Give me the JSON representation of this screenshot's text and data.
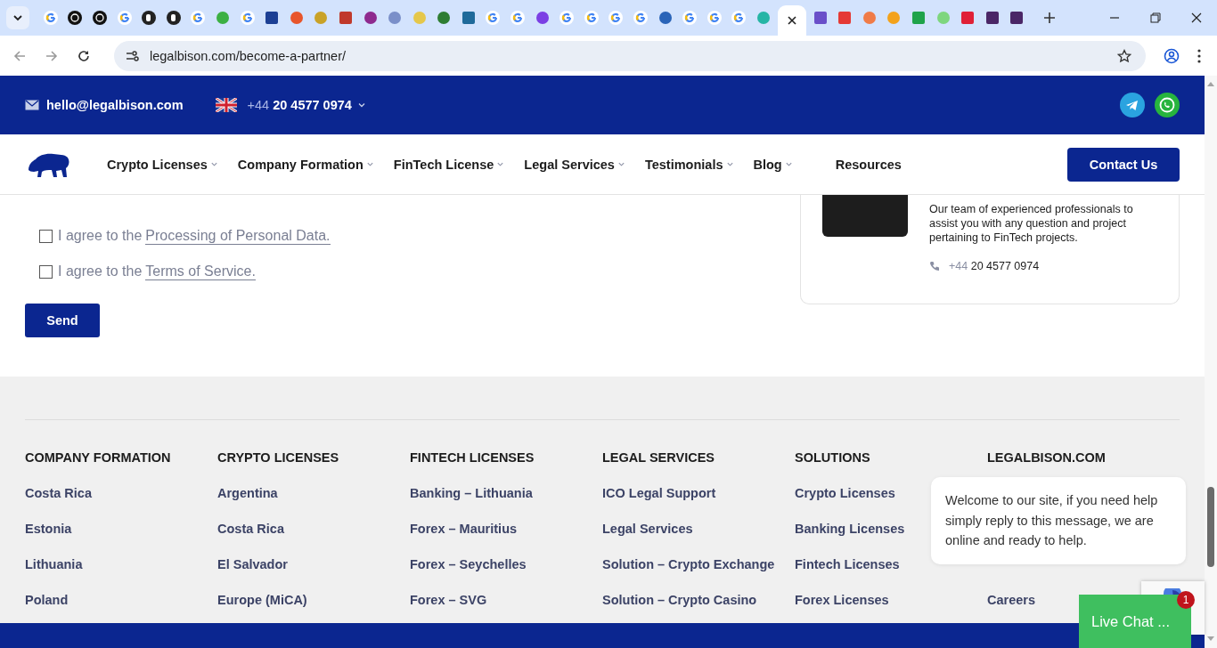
{
  "browser": {
    "tabs": [
      {
        "kind": "google",
        "selected": false
      },
      {
        "kind": "swirl",
        "selected": false
      },
      {
        "kind": "swirl",
        "selected": false
      },
      {
        "kind": "google",
        "selected": false
      },
      {
        "kind": "dark",
        "selected": false
      },
      {
        "kind": "dark",
        "selected": false
      },
      {
        "kind": "google",
        "selected": false
      },
      {
        "kind": "round",
        "color": "#3cb043",
        "selected": false
      },
      {
        "kind": "google",
        "selected": false
      },
      {
        "kind": "square",
        "color": "#1c3f94",
        "selected": false
      },
      {
        "kind": "round",
        "color": "#e8552b",
        "selected": false
      },
      {
        "kind": "round",
        "color": "#c9a227",
        "selected": false
      },
      {
        "kind": "square",
        "color": "#c0392b",
        "selected": false
      },
      {
        "kind": "round",
        "color": "#8e2a8e",
        "selected": false
      },
      {
        "kind": "round",
        "color": "#7a8fc9",
        "selected": false
      },
      {
        "kind": "round",
        "color": "#e5c74a",
        "selected": false
      },
      {
        "kind": "round",
        "color": "#2e7d32",
        "selected": false
      },
      {
        "kind": "square",
        "color": "#1f6a9a",
        "selected": false
      },
      {
        "kind": "google",
        "selected": false
      },
      {
        "kind": "google",
        "selected": false
      },
      {
        "kind": "round",
        "color": "#7b3fe4",
        "selected": false
      },
      {
        "kind": "google",
        "selected": false
      },
      {
        "kind": "google",
        "selected": false
      },
      {
        "kind": "google",
        "selected": false
      },
      {
        "kind": "google",
        "selected": false
      },
      {
        "kind": "round",
        "color": "#2a64b8",
        "selected": false
      },
      {
        "kind": "google",
        "selected": false
      },
      {
        "kind": "google",
        "selected": false
      },
      {
        "kind": "google",
        "selected": false
      },
      {
        "kind": "round",
        "color": "#26b5a5",
        "selected": false
      },
      {
        "kind": "none",
        "selected": true
      },
      {
        "kind": "square",
        "color": "#6a4fc9",
        "selected": false
      },
      {
        "kind": "square",
        "color": "#e53935",
        "selected": false
      },
      {
        "kind": "round",
        "color": "#f07b47",
        "selected": false
      },
      {
        "kind": "round",
        "color": "#f3a21b",
        "selected": false
      },
      {
        "kind": "square",
        "color": "#1fa34a",
        "selected": false
      },
      {
        "kind": "round",
        "color": "#7ed67e",
        "selected": false
      },
      {
        "kind": "square",
        "color": "#e02036",
        "selected": false
      },
      {
        "kind": "square",
        "color": "#4a2666",
        "selected": false
      },
      {
        "kind": "square",
        "color": "#4a2666",
        "selected": false
      }
    ],
    "address": "legalbison.com/become-a-partner/"
  },
  "topbar": {
    "email": "hello@legalbison.com",
    "phone_prefix": "+44",
    "phone": "20 4577 0974"
  },
  "nav": {
    "items": [
      {
        "label": "Crypto Licenses",
        "dropdown": true
      },
      {
        "label": "Company Formation",
        "dropdown": true
      },
      {
        "label": "FinTech License",
        "dropdown": true
      },
      {
        "label": "Legal Services",
        "dropdown": true
      },
      {
        "label": "Testimonials",
        "dropdown": true
      },
      {
        "label": "Blog",
        "dropdown": true
      },
      {
        "label": "Resources",
        "dropdown": false
      }
    ],
    "cta": "Contact Us"
  },
  "form": {
    "consents": [
      {
        "prefix": "I agree to the",
        "link": "Processing of Personal Data.",
        "checked": false
      },
      {
        "prefix": "I agree to the",
        "link": "Terms of Service.",
        "checked": false
      }
    ],
    "submit": "Send"
  },
  "contact_card": {
    "text": "Our team of experienced professionals to assist you with any question and project pertaining to FinTech projects.",
    "phone_prefix": "+44",
    "phone": "20 4577 0974"
  },
  "footer": {
    "columns": [
      {
        "heading": "COMPANY FORMATION",
        "links": [
          "Costa Rica",
          "Estonia",
          "Lithuania",
          "Poland"
        ]
      },
      {
        "heading": "CRYPTO LICENSES",
        "links": [
          "Argentina",
          "Costa Rica",
          "El Salvador",
          "Europe (MiCA)"
        ]
      },
      {
        "heading": "FINTECH LICENSES",
        "links": [
          "Banking – Lithuania",
          "Forex – Mauritius",
          "Forex – Seychelles",
          "Forex – SVG"
        ]
      },
      {
        "heading": "LEGAL SERVICES",
        "links": [
          "ICO Legal Support",
          "Legal Services",
          "Solution – Crypto Exchange",
          "Solution – Crypto Casino"
        ]
      },
      {
        "heading": "SOLUTIONS",
        "links": [
          "Crypto Licenses",
          "Banking Licenses",
          "Fintech Licenses",
          "Forex Licenses"
        ]
      },
      {
        "heading": "LEGALBISON.COM",
        "links": [
          "Careers"
        ]
      }
    ]
  },
  "chat": {
    "message": "Welcome to our site, if you need help simply reply to this message, we are online and ready to help.",
    "button": "Live Chat ...",
    "badge": "1"
  }
}
